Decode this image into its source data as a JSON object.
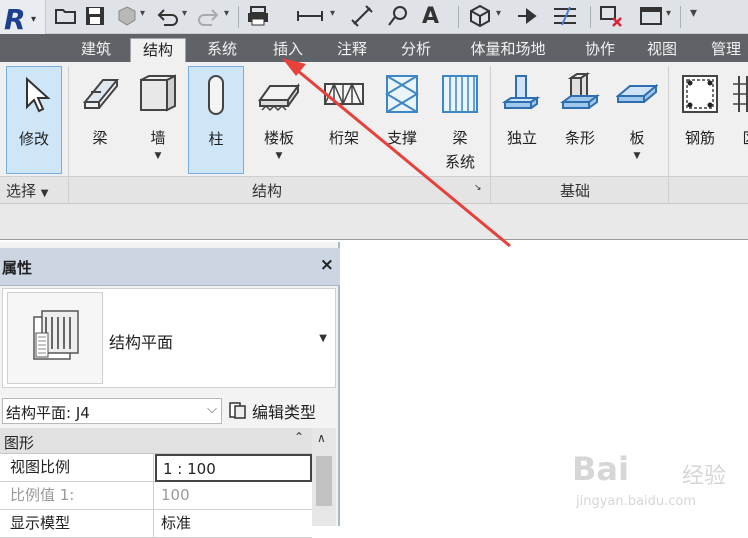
{
  "tabs": [
    "建筑",
    "结构",
    "系统",
    "插入",
    "注释",
    "分析",
    "体量和场地",
    "协作",
    "视图",
    "管理"
  ],
  "active_tab": "结构",
  "ribbon": {
    "buttons": [
      {
        "label": "修改",
        "icon": "cursor-arrow-icon",
        "selected": true
      },
      {
        "label": "梁",
        "icon": "beam-icon"
      },
      {
        "label": "墙",
        "icon": "wall-icon",
        "dropdown": true
      },
      {
        "label": "柱",
        "icon": "column-icon",
        "selected": true
      },
      {
        "label": "楼板",
        "icon": "floor-slab-icon",
        "dropdown": true
      },
      {
        "label": "桁架",
        "icon": "truss-icon"
      },
      {
        "label": "支撑",
        "icon": "brace-icon"
      },
      {
        "label": "梁",
        "label2": "系统",
        "icon": "beam-system-icon"
      },
      {
        "label": "独立",
        "icon": "isolated-foundation-icon"
      },
      {
        "label": "条形",
        "icon": "wall-foundation-icon"
      },
      {
        "label": "板",
        "icon": "foundation-slab-icon",
        "dropdown": true
      },
      {
        "label": "钢筋",
        "icon": "rebar-icon"
      },
      {
        "label": "区",
        "icon": "area-rebar-icon"
      }
    ],
    "panels": [
      {
        "label": "选择",
        "dropdown": true
      },
      {
        "label": "结构",
        "launcher": true
      },
      {
        "label": "基础"
      }
    ]
  },
  "properties": {
    "title": "属性",
    "close_icon": "×",
    "type_name": "结构平面",
    "selector_value": "结构平面: J4",
    "edit_type_label": "编辑类型",
    "group_title": "图形",
    "rows": [
      {
        "key": "视图比例",
        "value": "1 : 100",
        "editable": true
      },
      {
        "key": "比例值 1:",
        "value": "100",
        "disabled": true
      },
      {
        "key": "显示模型",
        "value": "标准"
      }
    ]
  },
  "watermark": {
    "text": "Bai",
    "zh": "经验",
    "url": "jingyan.baidu.com"
  },
  "colors": {
    "tab_bar": "#5f6367",
    "ribbon": "#f0f0f0",
    "selection": "#cfe6f8",
    "annotation": "#e8403a"
  }
}
